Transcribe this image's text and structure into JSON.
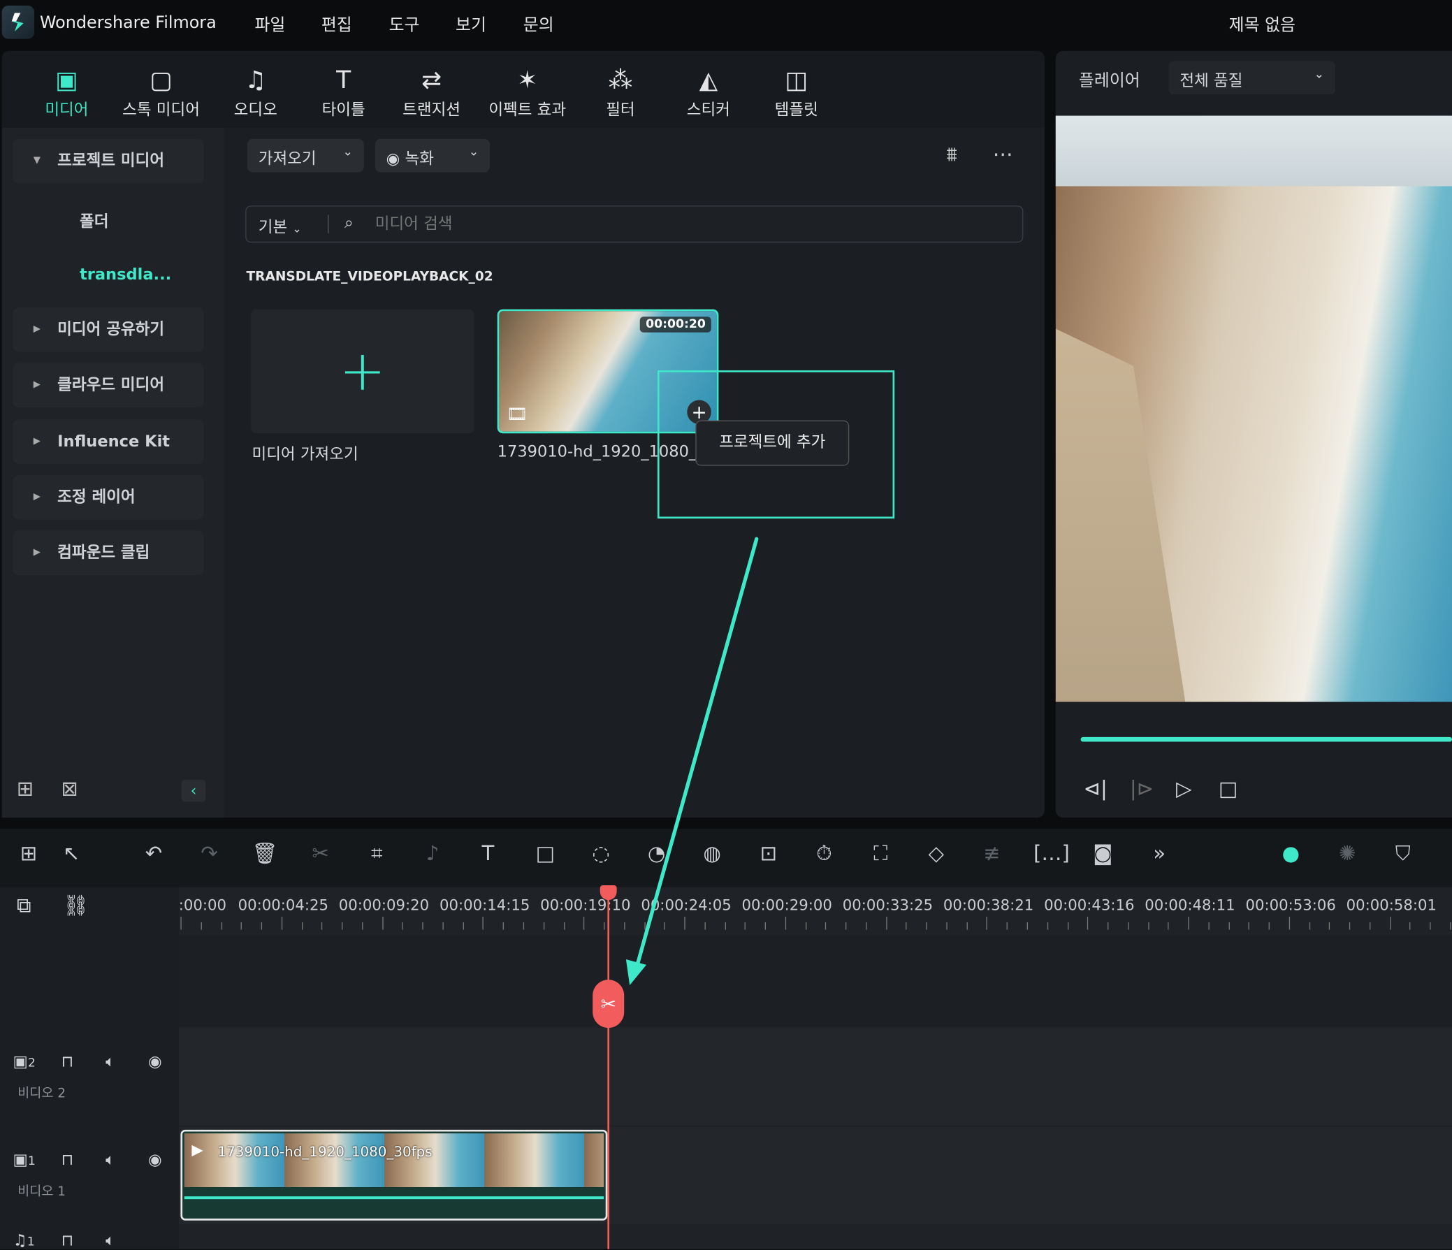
{
  "app": {
    "name": "Wondershare Filmora",
    "project_title": "제목 없음",
    "accent": "#3ee8c8"
  },
  "menu": [
    "파일",
    "편집",
    "도구",
    "보기",
    "문의"
  ],
  "toolbar": [
    {
      "label": "미디어",
      "icon": "media-icon",
      "active": true
    },
    {
      "label": "스톡 미디어",
      "icon": "stock-media-icon"
    },
    {
      "label": "오디오",
      "icon": "music-note-icon"
    },
    {
      "label": "타이틀",
      "icon": "title-t-icon"
    },
    {
      "label": "트랜지션",
      "icon": "transition-icon"
    },
    {
      "label": "이펙트 효과",
      "icon": "effects-star-icon"
    },
    {
      "label": "필터",
      "icon": "filter-icon"
    },
    {
      "label": "스티커",
      "icon": "sticker-icon"
    },
    {
      "label": "템플릿",
      "icon": "template-icon"
    }
  ],
  "sidebar": {
    "project_media": "프로젝트 미디어",
    "folder": "폴더",
    "active_folder": "transdla...",
    "items": [
      "미디어 공유하기",
      "클라우드 미디어",
      "Influence Kit",
      "조정 레이어",
      "컴파운드 클립"
    ]
  },
  "media": {
    "import": "가져오기",
    "record": "녹화",
    "view_mode": "기본",
    "search_placeholder": "미디어 검색",
    "folder_title": "TRANSDLATE_VIDEOPLAYBACK_02",
    "import_tile_label": "미디어 가져오기",
    "clip": {
      "name": "1739010-hd_1920_1080_3",
      "duration": "00:00:20"
    },
    "tooltip": "프로젝트에 추가"
  },
  "player": {
    "label": "플레이어",
    "quality": "전체 품질",
    "progress": 1.0
  },
  "timeline": {
    "ruler": [
      ":00:00",
      "00:00:04:25",
      "00:00:09:20",
      "00:00:14:15",
      "00:00:19:10",
      "00:00:24:05",
      "00:00:29:00",
      "00:00:33:25",
      "00:00:38:21",
      "00:00:43:16",
      "00:00:48:11",
      "00:00:53:06",
      "00:00:58:01"
    ],
    "playhead": "00:00:19:10",
    "tracks": [
      {
        "num": "2",
        "name": "비디오 2"
      },
      {
        "num": "1",
        "name": "비디오 1"
      },
      {
        "num": "1",
        "name": ""
      }
    ],
    "clip_name": "1739010-hd_1920_1080_30fps"
  }
}
